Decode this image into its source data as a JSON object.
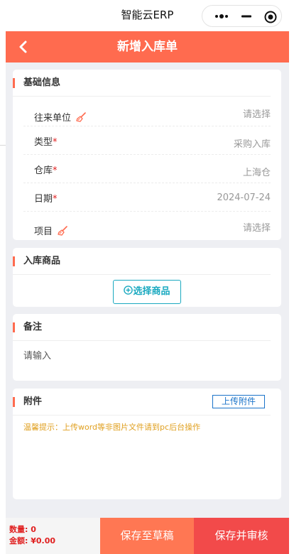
{
  "app": {
    "title": "智能云ERP"
  },
  "navbar": {
    "title": "新增入库单"
  },
  "basic": {
    "title": "基础信息",
    "fields": [
      {
        "label": "往来单位",
        "required": "",
        "value": "请选择"
      },
      {
        "label": "类型",
        "required": "*",
        "value": "采购入库"
      },
      {
        "label": "仓库",
        "required": "*",
        "value": "上海仓"
      },
      {
        "label": "日期",
        "required": "*",
        "value": "2024-07-24"
      },
      {
        "label": "项目",
        "required": "",
        "value": "请选择"
      }
    ]
  },
  "goods": {
    "title": "入库商品",
    "pick_label": "选择商品"
  },
  "remark": {
    "title": "备注",
    "placeholder": "请输入"
  },
  "attachment": {
    "title": "附件",
    "upload_label": "上传附件",
    "tip": "温馨提示：上传word等非图片文件请到pc后台操作"
  },
  "footer": {
    "qty_label": "数量:",
    "qty_value": "0",
    "amount_label": "金额:",
    "amount_value": "¥0.00",
    "draft_label": "保存至草稿",
    "submit_label": "保存并审核"
  },
  "colors": {
    "accent": "#ff6b4f",
    "draft": "#ff7753",
    "submit": "#f24a4a",
    "link": "#1aa9c0",
    "tip": "#e0a020"
  }
}
